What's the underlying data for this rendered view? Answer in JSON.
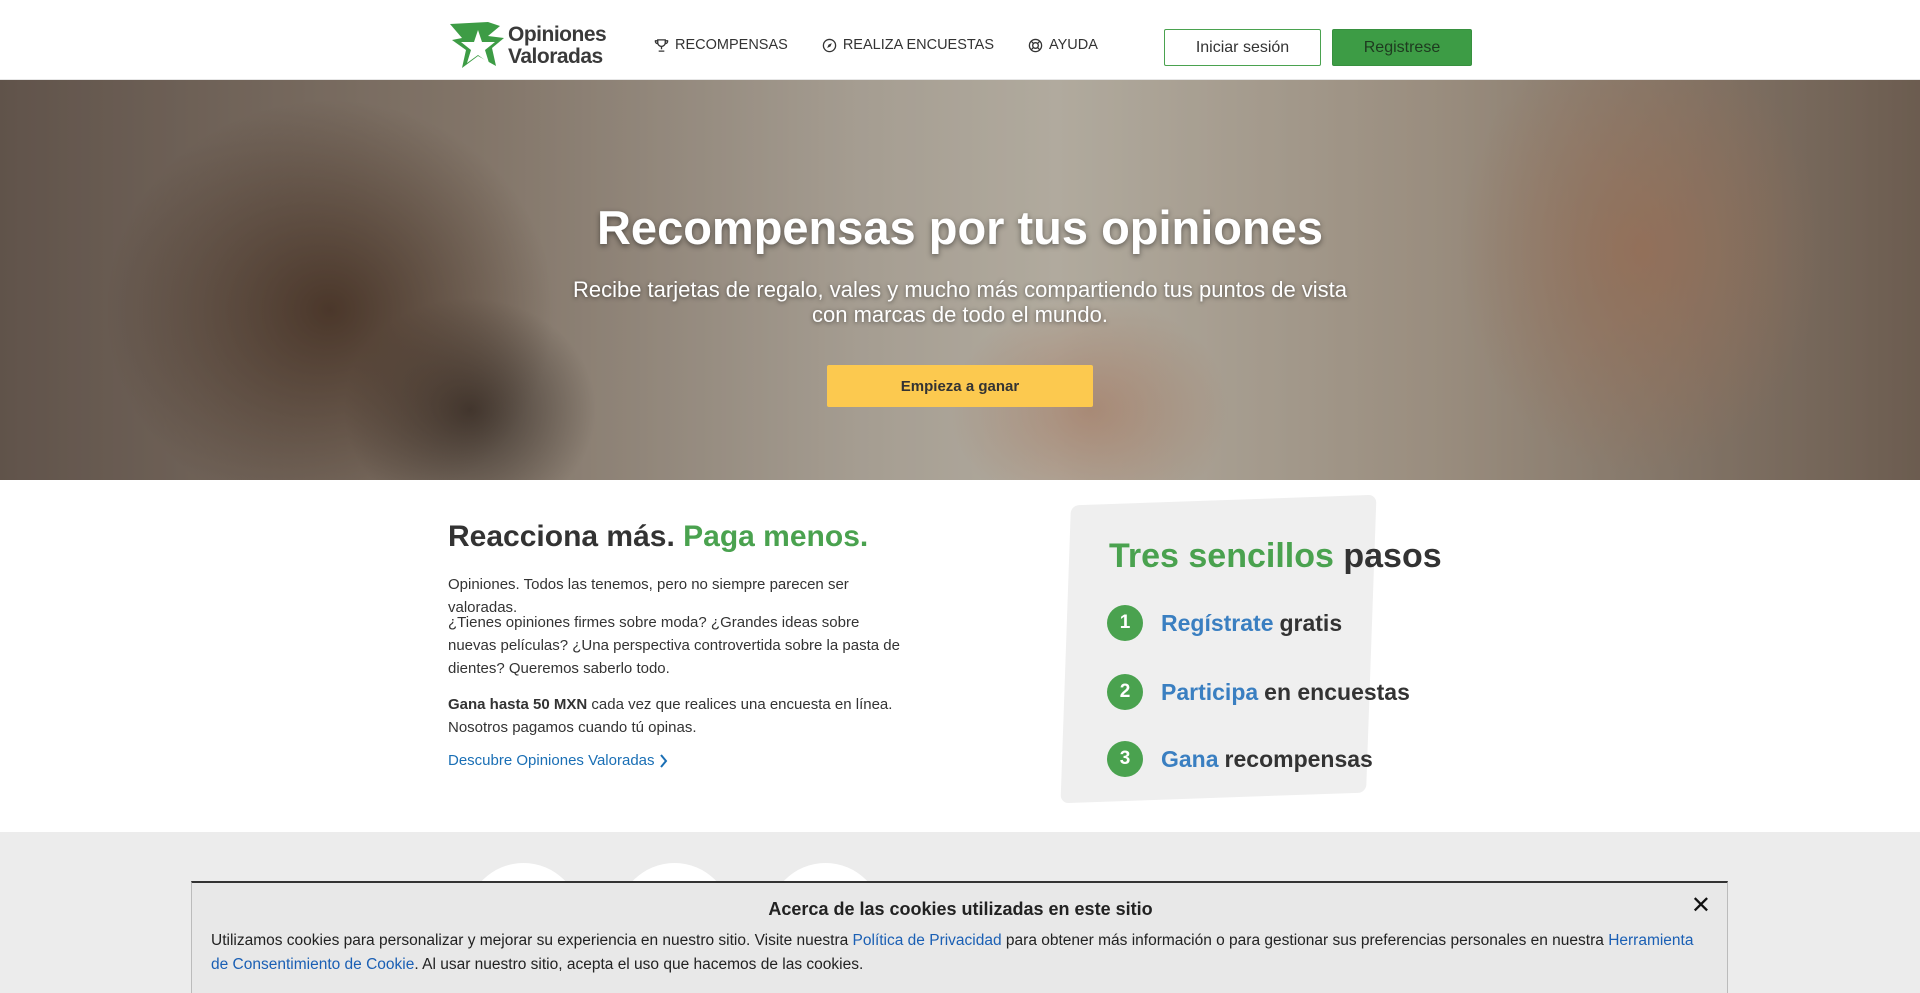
{
  "brand": {
    "line1": "Opiniones",
    "line2": "Valoradas",
    "green": "#4aa24f",
    "yellow": "#fcc94f",
    "link_blue": "#1a6fb5"
  },
  "nav": {
    "items": [
      {
        "label": "RECOMPENSAS",
        "icon": "trophy-icon"
      },
      {
        "label": "REALIZA ENCUESTAS",
        "icon": "compass-icon"
      },
      {
        "label": "AYUDA",
        "icon": "lifebuoy-icon"
      }
    ],
    "login_label": "Iniciar sesión",
    "register_label": "Registrese"
  },
  "hero": {
    "title": "Recompensas por tus opiniones",
    "subtitle": "Recibe tarjetas de regalo, vales y mucho más compartiendo tus puntos de vista con marcas de todo el mundo.",
    "cta_label": "Empieza a ganar"
  },
  "intro": {
    "title_part1": "Reacciona más.",
    "title_part2": "Paga menos.",
    "p1": "Opiniones. Todos las tenemos, pero no siempre parecen ser valoradas.",
    "p2": "¿Tienes opiniones firmes sobre moda? ¿Grandes ideas sobre nuevas películas? ¿Una perspectiva controvertida sobre la pasta de dientes? Queremos saberlo todo.",
    "p3_bold": "Gana hasta 50 MXN",
    "p3_rest": " cada vez que realices una encuesta en línea. Nosotros pagamos cuando tú opinas.",
    "discover_link": "Descubre Opiniones Valoradas"
  },
  "steps": {
    "title_green": "Tres sencillos",
    "title_rest": "pasos",
    "items": [
      {
        "num": "1",
        "highlight": "Regístrate",
        "rest": "gratis"
      },
      {
        "num": "2",
        "highlight": "Participa",
        "rest": "en encuestas"
      },
      {
        "num": "3",
        "highlight": "Gana",
        "rest": "recompensas"
      }
    ]
  },
  "cookie": {
    "title": "Acerca de las cookies utilizadas en este sitio",
    "close": "✕",
    "text_part1": "Utilizamos cookies para personalizar y mejorar su experiencia en nuestro sitio. Visite nuestra ",
    "link1": "Política de Privacidad",
    "text_part2": " para obtener más información o para gestionar sus preferencias personales en nuestra ",
    "link2": "Herramienta de Consentimiento de Cookie",
    "text_part3": ". Al usar nuestro sitio, acepta el uso que hacemos de las cookies."
  }
}
